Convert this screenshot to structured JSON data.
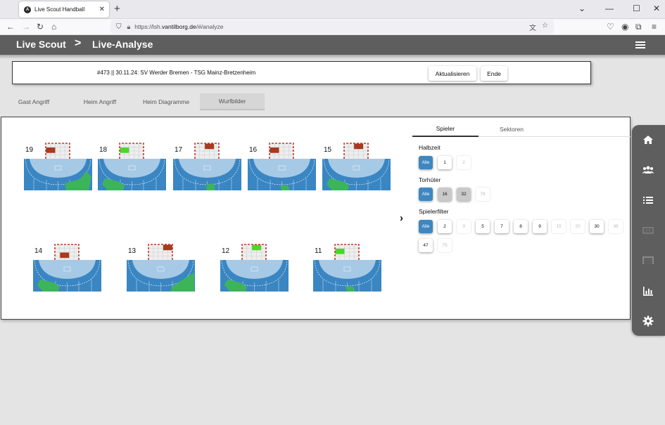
{
  "browser": {
    "tab_title": "Live Scout Handball",
    "url_prefix": "https://lsh.",
    "url_host": "vantilborg.de",
    "url_path": "/#/analyze"
  },
  "app": {
    "brand": "Live Scout",
    "separator": ">",
    "page": "Live-Analyse"
  },
  "match": {
    "title": "#473 || 30.11.24: SV Werder Bremen - TSG Mainz-Bretzenheim",
    "refresh_label": "Aktualisieren",
    "end_label": "Ende"
  },
  "tabs": [
    "Gast Angriff",
    "Heim Angriff",
    "Heim Diagramme",
    "Wurfbilder"
  ],
  "active_tab": "Wurfbilder",
  "shot_players": [
    {
      "number": "19",
      "goal_cell": [
        0,
        1
      ],
      "goal_color": "#a83a1e",
      "sector": "right-wing",
      "sector_color": "#3cb55a"
    },
    {
      "number": "18",
      "goal_cell": [
        0,
        1
      ],
      "goal_color": "#4cd62a",
      "sector": "left-back",
      "sector_color": "#3cb55a"
    },
    {
      "number": "17",
      "goal_cell": [
        2,
        0
      ],
      "goal_color": "#a83a1e",
      "sector": "center-right",
      "sector_color": "#3cb55a"
    },
    {
      "number": "16",
      "goal_cell": [
        0,
        1
      ],
      "goal_color": "#a83a1e",
      "sector": "center-low",
      "sector_color": "#3cb55a"
    },
    {
      "number": "15",
      "goal_cell": [
        2,
        0
      ],
      "goal_color": "#a83a1e",
      "sector": "left-back",
      "sector_color": "#3cb55a"
    },
    {
      "number": "14",
      "goal_cell": [
        1,
        2
      ],
      "goal_color": "#a83a1e",
      "sector": "left-back",
      "sector_color": "#3cb55a"
    },
    {
      "number": "13",
      "goal_cell": [
        3,
        0
      ],
      "goal_color": "#a83a1e",
      "sector": "right-corner",
      "sector_color": "#3cb55a"
    },
    {
      "number": "12",
      "goal_cell": [
        2,
        0
      ],
      "goal_color": "#4cd62a",
      "sector": "left-back",
      "sector_color": "#3cb55a"
    },
    {
      "number": "11",
      "goal_cell": [
        0,
        1
      ],
      "goal_color": "#4cd62a",
      "sector": "center-low",
      "sector_color": "#3cb55a"
    }
  ],
  "filters": {
    "subtabs": [
      "Spieler",
      "Sektoren"
    ],
    "active_subtab": "Spieler",
    "halftime": {
      "label": "Halbzeit",
      "chips": [
        {
          "text": "Alle",
          "state": "sel"
        },
        {
          "text": "1",
          "state": "on"
        },
        {
          "text": "2",
          "state": "dim"
        }
      ]
    },
    "goalkeeper": {
      "label": "Torhüter",
      "chips": [
        {
          "text": "Alle",
          "state": "sel"
        },
        {
          "text": "16",
          "state": "gray"
        },
        {
          "text": "32",
          "state": "gray"
        },
        {
          "text": "78",
          "state": "dim"
        }
      ]
    },
    "players": {
      "label": "Spielerfilter",
      "chips": [
        {
          "text": "Alle",
          "state": "sel"
        },
        {
          "text": "2",
          "state": "on"
        },
        {
          "text": "3",
          "state": "dim"
        },
        {
          "text": "5",
          "state": "on"
        },
        {
          "text": "7",
          "state": "on"
        },
        {
          "text": "8",
          "state": "on"
        },
        {
          "text": "9",
          "state": "on"
        },
        {
          "text": "15",
          "state": "dim"
        },
        {
          "text": "20",
          "state": "dim"
        },
        {
          "text": "30",
          "state": "on"
        },
        {
          "text": "36",
          "state": "dim"
        },
        {
          "text": "47",
          "state": "on"
        },
        {
          "text": "75",
          "state": "dim"
        }
      ]
    }
  },
  "sidenav": [
    "home-icon",
    "team-icon",
    "list-icon",
    "scoreboard-icon",
    "goal-icon",
    "bar-chart-icon",
    "gear-icon"
  ],
  "colors": {
    "court_blue": "#3a86c3",
    "zone_light": "#a6c9e6",
    "shot_green": "#3cb55a",
    "goal_red": "#a83a1e",
    "goal_green": "#4cd62a",
    "selected_chip": "#3f87c0",
    "header_gray": "#5e5e5e"
  }
}
